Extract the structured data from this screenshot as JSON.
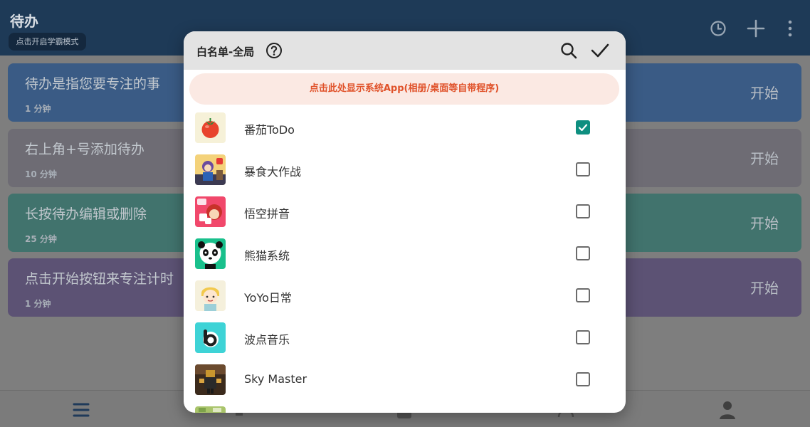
{
  "app": {
    "title": "待办",
    "mode_chip": "点击开启学霸模式"
  },
  "tasks": [
    {
      "title": "待办是指您要专注的事",
      "duration": "1 分钟",
      "start": "开始",
      "color": "#3a5b85"
    },
    {
      "title": "右上角+号添加待办",
      "duration": "10 分钟",
      "start": "开始",
      "color": "#6e6c74"
    },
    {
      "title": "长按待办编辑或删除",
      "duration": "25 分钟",
      "start": "开始",
      "color": "#41736d"
    },
    {
      "title": "点击开始按钮来专注计时",
      "duration": "1 分钟",
      "start": "开始",
      "color": "#5c5274"
    }
  ],
  "dialog": {
    "title": "白名单-全局",
    "banner": "点击此处显示系统App(相册/桌面等自带程序)",
    "accent_color": "#0e8f80",
    "banner_text_color": "#e0522a",
    "apps": [
      {
        "name": "番茄ToDo",
        "checked": true,
        "icon": "tomato-icon"
      },
      {
        "name": "暴食大作战",
        "checked": false,
        "icon": "game-character-icon"
      },
      {
        "name": "悟空拼音",
        "checked": false,
        "icon": "wukong-icon"
      },
      {
        "name": "熊猫系统",
        "checked": false,
        "icon": "panda-icon"
      },
      {
        "name": "YoYo日常",
        "checked": false,
        "icon": "yoyo-icon"
      },
      {
        "name": "波点音乐",
        "checked": false,
        "icon": "bodian-music-icon"
      },
      {
        "name": "Sky Master",
        "checked": false,
        "icon": "sky-master-icon"
      }
    ]
  }
}
